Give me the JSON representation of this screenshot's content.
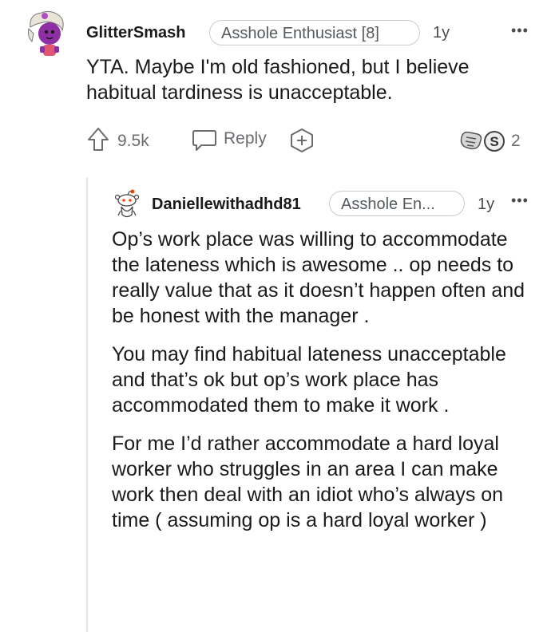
{
  "comment": {
    "username": "GlitterSmash",
    "flair": "Asshole Enthusiast [8]",
    "age": "1y",
    "more_icon": "more-options-icon",
    "text": "YTA. Maybe I'm old fashioned, but I believe habitual tardiness is unacceptable.",
    "actions": {
      "upvote_count": "9.5k",
      "reply_label": "Reply",
      "award_count": "2"
    }
  },
  "reply": {
    "username": "Daniellewithadhd81",
    "flair": "Asshole En...",
    "age": "1y",
    "paragraphs": [
      "Op’s work place was willing to accommodate the lateness which is awesome .. op needs to really value that as it doesn’t happen often and be honest with the manager .",
      "You may find habitual lateness unacceptable and that’s ok but op’s work place has accommodated them to make it work .",
      "For me I’d rather accommodate a hard loyal worker who struggles in an area I can make work then deal with an idiot who’s always on time ( assuming op is a hard loyal worker )"
    ]
  },
  "colors": {
    "text": "#1a1a1b",
    "secondary": "#6a6d70",
    "flair_border": "#c9ccd0",
    "avatar_purple": "#8e2fa6"
  }
}
